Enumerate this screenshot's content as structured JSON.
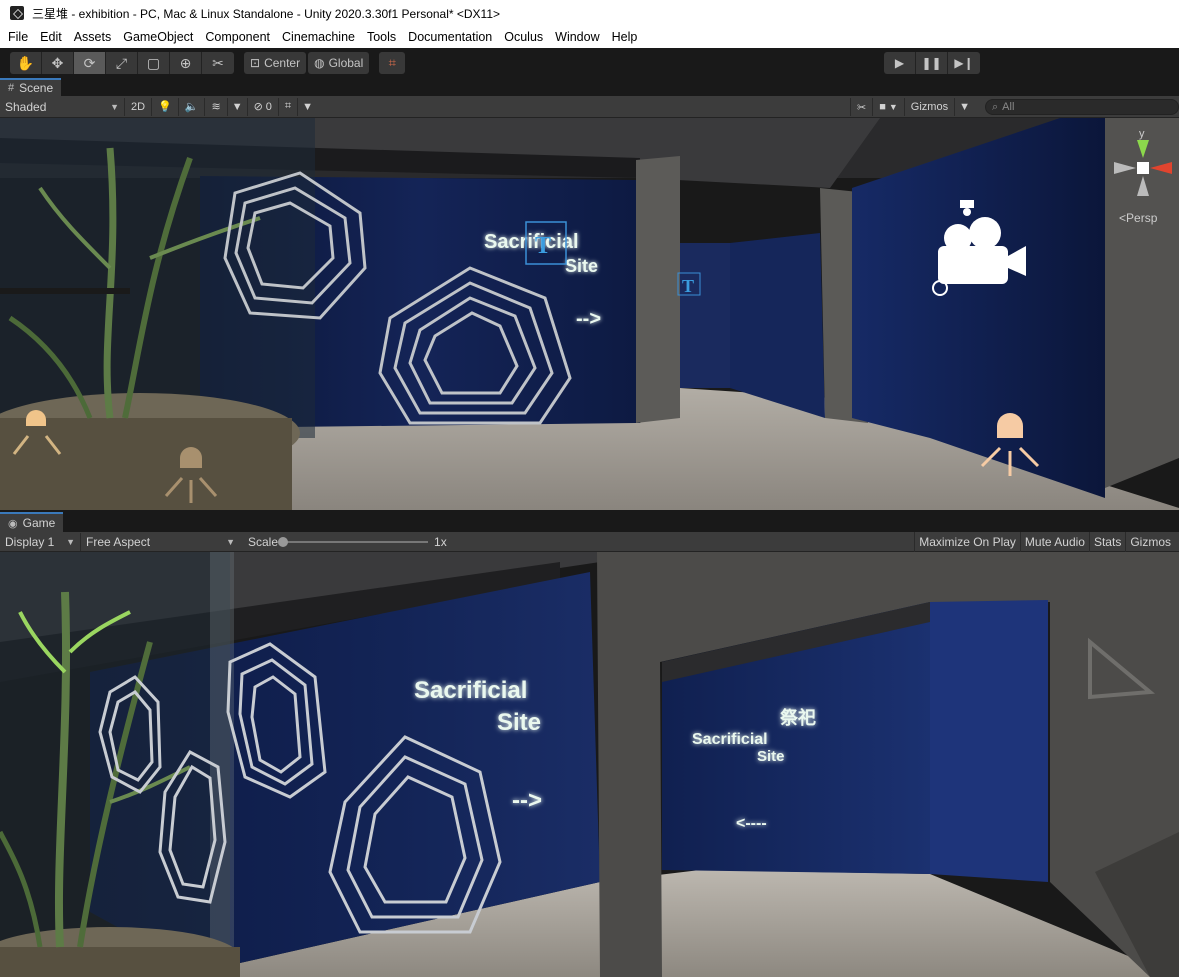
{
  "window": {
    "title": "三星堆 - exhibition - PC, Mac & Linux Standalone - Unity 2020.3.30f1 Personal* <DX11>"
  },
  "menu": {
    "items": [
      "File",
      "Edit",
      "Assets",
      "GameObject",
      "Component",
      "Cinemachine",
      "Tools",
      "Documentation",
      "Oculus",
      "Window",
      "Help"
    ]
  },
  "toolbar": {
    "pivot_label": "Center",
    "space_label": "Global"
  },
  "scene": {
    "tab_label": "Scene",
    "shading_mode": "Shaded",
    "mode_2d_label": "2D",
    "hidden_count": "0",
    "gizmos_label": "Gizmos",
    "search_placeholder": "All",
    "persp_label": "Persp",
    "axis_y_label": "y",
    "signs": {
      "line1": "Sacrificial",
      "line2": "Site",
      "arrow": "-->"
    }
  },
  "game": {
    "tab_label": "Game",
    "display_label": "Display 1",
    "aspect_label": "Free Aspect",
    "scale_label": "Scale",
    "scale_value": "1x",
    "maximize_label": "Maximize On Play",
    "mute_label": "Mute Audio",
    "stats_label": "Stats",
    "gizmos_label": "Gizmos",
    "signs": {
      "line1": "Sacrificial",
      "line2": "Site",
      "arrow_right": "-->",
      "arrow_left": "<----",
      "far_line1": "Sacrificial",
      "far_line2": "Site",
      "far_glyphs": "祭祀"
    }
  },
  "colors": {
    "wall_blue": "#0f1d4a",
    "floor": "#a9a49c",
    "glow_text": "#eaf8ef",
    "tab_accent": "#3a79bb",
    "gizmo_light": "#f6cba4"
  }
}
